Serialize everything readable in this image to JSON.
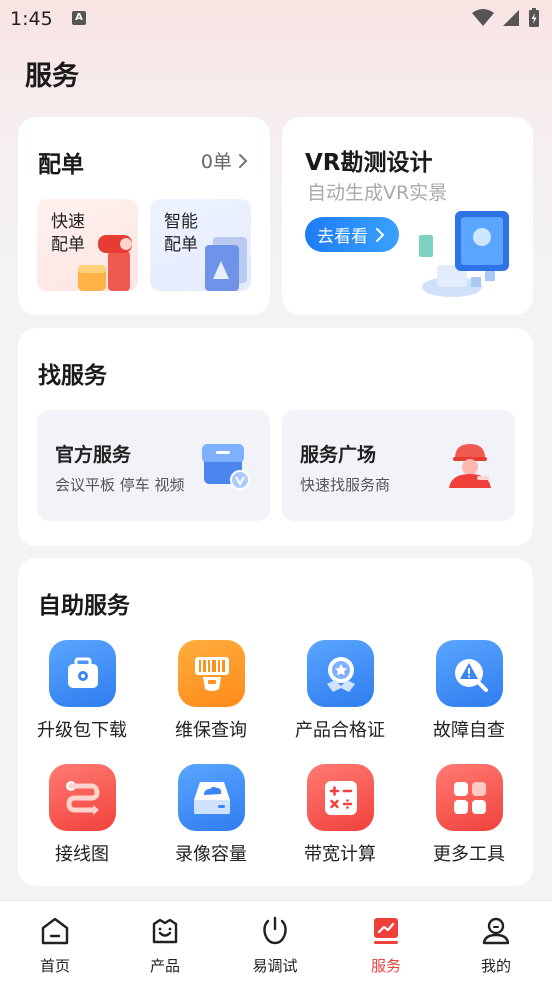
{
  "status_bar": {
    "time": "1:45",
    "indicator": "A"
  },
  "page": {
    "title": "服务"
  },
  "peidan": {
    "title": "配单",
    "count": "0单",
    "quick_label": "快速配单",
    "smart_label": "智能配单"
  },
  "vr": {
    "title": "VR勘测设计",
    "subtitle": "自动生成VR实景",
    "button": "去看看"
  },
  "find_service": {
    "title": "找服务",
    "official": {
      "title": "官方服务",
      "subtitle": "会议平板 停车 视频"
    },
    "square": {
      "title": "服务广场",
      "subtitle": "快速找服务商"
    }
  },
  "self_service": {
    "title": "自助服务",
    "items": [
      {
        "label": "升级包下载",
        "icon": "toolbox-icon",
        "color": "#3a86f5"
      },
      {
        "label": "维保查询",
        "icon": "barcode-scan-icon",
        "color": "#ff931f"
      },
      {
        "label": "产品合格证",
        "icon": "certificate-badge-icon",
        "color": "#3a86f5"
      },
      {
        "label": "故障自查",
        "icon": "warning-search-icon",
        "color": "#3a86f5"
      },
      {
        "label": "接线图",
        "icon": "wiring-icon",
        "color": "#f2413c"
      },
      {
        "label": "录像容量",
        "icon": "storage-cloud-icon",
        "color": "#3a86f5"
      },
      {
        "label": "带宽计算",
        "icon": "calculator-icon",
        "color": "#f2413c"
      },
      {
        "label": "更多工具",
        "icon": "more-grid-icon",
        "color": "#f2413c"
      }
    ]
  },
  "bottom_nav": {
    "items": [
      {
        "label": "首页",
        "icon": "home-icon"
      },
      {
        "label": "产品",
        "icon": "product-icon"
      },
      {
        "label": "易调试",
        "icon": "debug-icon"
      },
      {
        "label": "服务",
        "icon": "service-icon"
      },
      {
        "label": "我的",
        "icon": "profile-icon"
      }
    ],
    "active": "服务"
  },
  "colors": {
    "accent_red": "#f0403c",
    "accent_blue": "#2f7cf0"
  }
}
